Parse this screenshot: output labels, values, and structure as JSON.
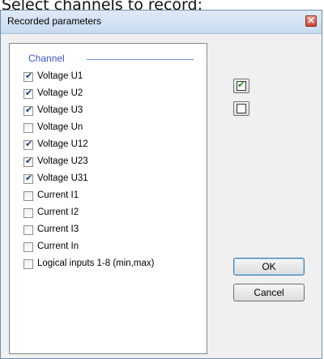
{
  "caption": "Select channels to record:",
  "window": {
    "title": "Recorded parameters"
  },
  "group": {
    "title": "Channel"
  },
  "channels": [
    {
      "label": "Voltage U1",
      "checked": true
    },
    {
      "label": "Voltage U2",
      "checked": true
    },
    {
      "label": "Voltage U3",
      "checked": true
    },
    {
      "label": "Voltage Un",
      "checked": false
    },
    {
      "label": "Voltage U12",
      "checked": true
    },
    {
      "label": "Voltage U23",
      "checked": true
    },
    {
      "label": "Voltage U31",
      "checked": true
    },
    {
      "label": "Current I1",
      "checked": false
    },
    {
      "label": "Current I2",
      "checked": false
    },
    {
      "label": "Current I3",
      "checked": false
    },
    {
      "label": "Current In",
      "checked": false
    },
    {
      "label": "Logical inputs 1-8 (min,max)",
      "checked": false
    }
  ],
  "buttons": {
    "ok": "OK",
    "cancel": "Cancel"
  }
}
